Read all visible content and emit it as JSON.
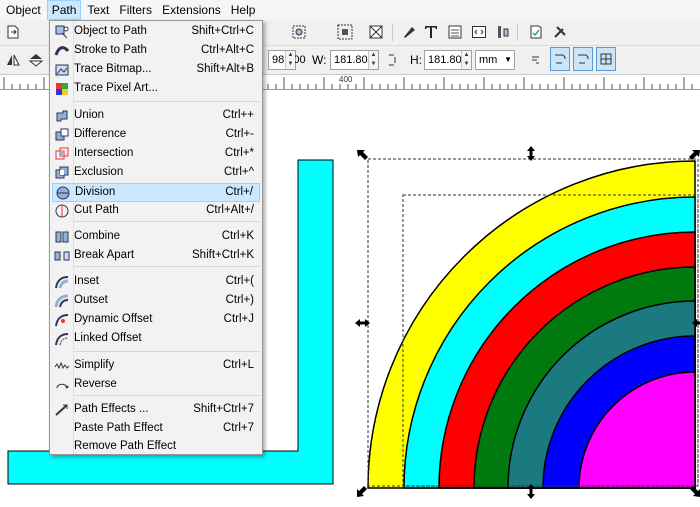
{
  "menubar": {
    "items": [
      {
        "label": "Object"
      },
      {
        "label": "Path"
      },
      {
        "label": "Text"
      },
      {
        "label": "Filters"
      },
      {
        "label": "Extensions"
      },
      {
        "label": "Help"
      }
    ]
  },
  "toolbar": {
    "x_value": "98.100",
    "w_label": "W:",
    "w_value": "181.806",
    "h_label": "H:",
    "h_value": "181.800",
    "unit": "mm"
  },
  "ruler": {
    "tick_label": "400"
  },
  "path_menu": {
    "items": [
      {
        "label": "Object to Path",
        "shortcut": "Shift+Ctrl+C",
        "icon": "object-to-path-icon"
      },
      {
        "label": "Stroke to Path",
        "shortcut": "Ctrl+Alt+C",
        "icon": "stroke-to-path-icon"
      },
      {
        "label": "Trace Bitmap...",
        "shortcut": "Shift+Alt+B",
        "icon": "trace-bitmap-icon"
      },
      {
        "label": "Trace Pixel Art...",
        "shortcut": "",
        "icon": "trace-pixel-art-icon"
      },
      {
        "label": "Union",
        "shortcut": "Ctrl++",
        "icon": "union-icon"
      },
      {
        "label": "Difference",
        "shortcut": "Ctrl+-",
        "icon": "difference-icon"
      },
      {
        "label": "Intersection",
        "shortcut": "Ctrl+*",
        "icon": "intersection-icon"
      },
      {
        "label": "Exclusion",
        "shortcut": "Ctrl+^",
        "icon": "exclusion-icon"
      },
      {
        "label": "Division",
        "shortcut": "Ctrl+/",
        "icon": "division-icon"
      },
      {
        "label": "Cut Path",
        "shortcut": "Ctrl+Alt+/",
        "icon": "cut-path-icon"
      },
      {
        "label": "Combine",
        "shortcut": "Ctrl+K",
        "icon": "combine-icon"
      },
      {
        "label": "Break Apart",
        "shortcut": "Shift+Ctrl+K",
        "icon": "break-apart-icon"
      },
      {
        "label": "Inset",
        "shortcut": "Ctrl+(",
        "icon": "inset-icon"
      },
      {
        "label": "Outset",
        "shortcut": "Ctrl+)",
        "icon": "outset-icon"
      },
      {
        "label": "Dynamic Offset",
        "shortcut": "Ctrl+J",
        "icon": "dynamic-offset-icon"
      },
      {
        "label": "Linked Offset",
        "shortcut": "",
        "icon": "linked-offset-icon"
      },
      {
        "label": "Simplify",
        "shortcut": "Ctrl+L",
        "icon": "simplify-icon"
      },
      {
        "label": "Reverse",
        "shortcut": "",
        "icon": "reverse-icon"
      },
      {
        "label": "Path Effects ...",
        "shortcut": "Shift+Ctrl+7",
        "icon": "path-effects-icon"
      },
      {
        "label": "Paste Path Effect",
        "shortcut": "Ctrl+7",
        "icon": ""
      },
      {
        "label": "Remove Path Effect",
        "shortcut": "",
        "icon": ""
      }
    ],
    "highlighted": "Division"
  },
  "colors": {
    "arc_yellow": "#ffff00",
    "arc_cyan": "#00ffff",
    "arc_red": "#ff0000",
    "arc_green": "#007a0f",
    "arc_teal": "#1a7a80",
    "arc_blue": "#0000ff",
    "arc_magenta": "#ff00ff",
    "shape_cyan": "#00ffff",
    "menu_highlight": "#cce8ff"
  }
}
